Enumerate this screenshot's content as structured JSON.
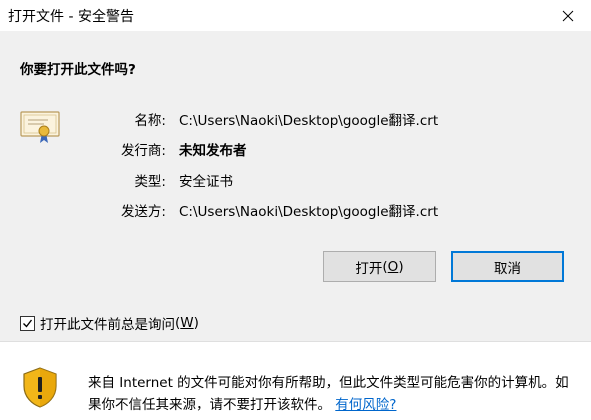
{
  "window": {
    "title": "打开文件 - 安全警告",
    "close_icon": "close-icon"
  },
  "question": "你要打开此文件吗?",
  "file_info": {
    "name_label": "名称:",
    "name_value": "C:\\Users\\Naoki\\Desktop\\google翻译.crt",
    "publisher_label": "发行商:",
    "publisher_value": "未知发布者",
    "type_label": "类型:",
    "type_value": "安全证书",
    "from_label": "发送方:",
    "from_value": "C:\\Users\\Naoki\\Desktop\\google翻译.crt",
    "icon": "certificate-icon"
  },
  "buttons": {
    "open_text": "打开",
    "open_prefix": "(",
    "open_key": "O",
    "open_suffix": ")",
    "cancel_label": "取消"
  },
  "checkbox": {
    "checked": true,
    "label_text": "打开此文件前总是询问",
    "label_prefix": "(",
    "label_key": "W",
    "label_suffix": ")"
  },
  "warning": {
    "icon": "warning-shield-icon",
    "text": "来自 Internet 的文件可能对你有所帮助，但此文件类型可能危害你的计算机。如果你不信任其来源，请不要打开该软件。",
    "link_label": "有何风险?"
  },
  "colors": {
    "accent": "#0078d7",
    "link": "#0066cc",
    "panel_bg": "#f0f0f0"
  }
}
